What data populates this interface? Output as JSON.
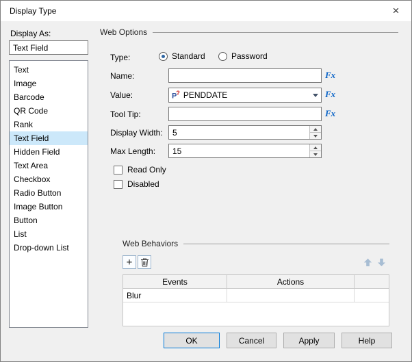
{
  "colors": {
    "accent": "#0078d7",
    "selection": "#cce8fa",
    "fx": "#0a64c8"
  },
  "dialog": {
    "title": "Display Type",
    "close_glyph": "×"
  },
  "left": {
    "label": "Display As:",
    "value": "Text Field",
    "selected_index": 5,
    "items": [
      "Text",
      "Image",
      "Barcode",
      "QR Code",
      "Rank",
      "Text Field",
      "Hidden Field",
      "Text Area",
      "Checkbox",
      "Radio Button",
      "Image Button",
      "Button",
      "List",
      "Drop-down List"
    ]
  },
  "web_options": {
    "section_title": "Web Options",
    "type_label": "Type:",
    "type_options": [
      {
        "label": "Standard",
        "selected": true
      },
      {
        "label": "Password",
        "selected": false
      }
    ],
    "fx_label": "Fx",
    "parameter_glyph": {
      "letter": "P",
      "mark": "?"
    },
    "fields": [
      {
        "label": "Name:",
        "value": ""
      },
      {
        "label": "Value:",
        "value": "PENDDATE"
      },
      {
        "label": "Tool Tip:",
        "value": ""
      },
      {
        "label": "Display Width:",
        "value": "5"
      },
      {
        "label": "Max Length:",
        "value": "15"
      }
    ],
    "checkboxes": [
      {
        "label": "Read Only",
        "checked": false
      },
      {
        "label": "Disabled",
        "checked": false
      }
    ]
  },
  "web_behaviors": {
    "section_title": "Web Behaviors",
    "icons": {
      "add": "+",
      "delete": "trash-can",
      "move_up": "up-arrow",
      "move_down": "down-arrow"
    },
    "table": {
      "headers": [
        "Events",
        "Actions"
      ],
      "rows": [
        [
          "Blur",
          ""
        ]
      ]
    }
  },
  "footer": {
    "buttons": [
      "OK",
      "Cancel",
      "Apply",
      "Help"
    ]
  }
}
